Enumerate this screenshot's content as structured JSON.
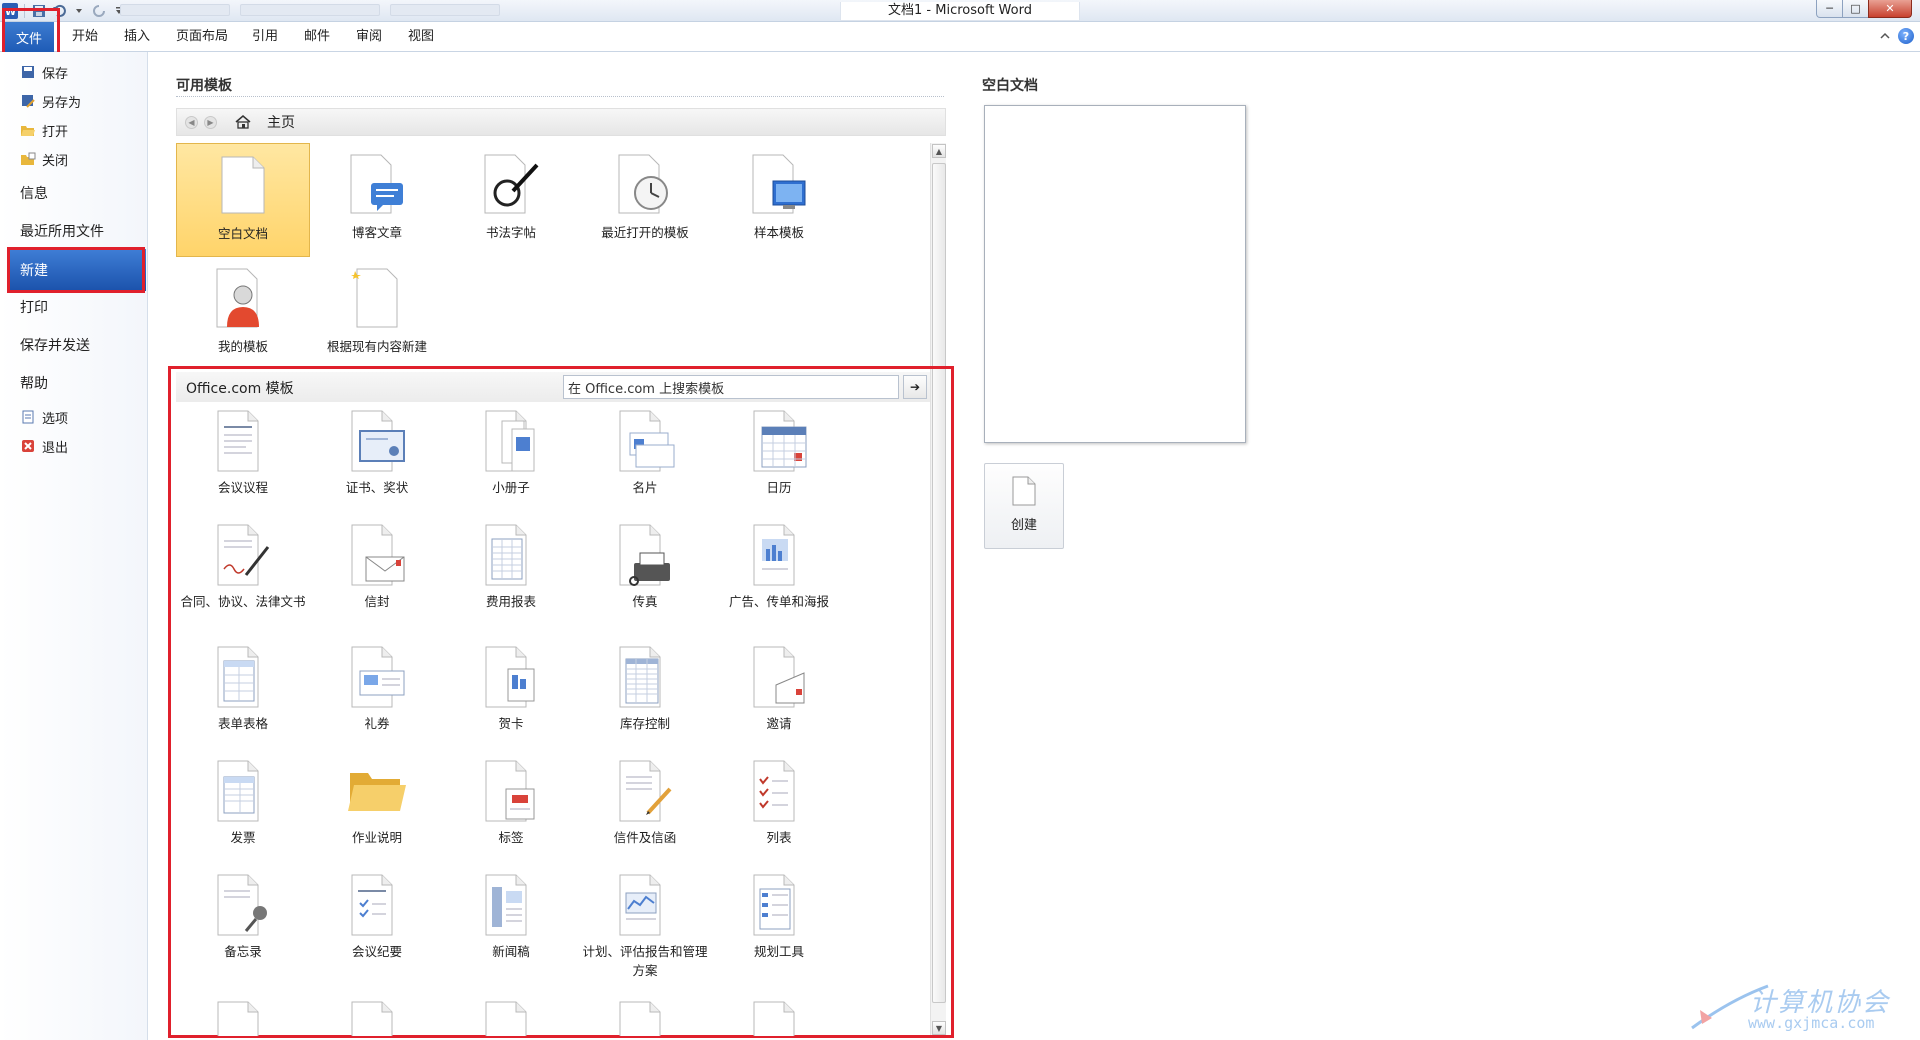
{
  "window": {
    "title": "文档1 - Microsoft Word",
    "controls": {
      "minimize": "─",
      "maximize": "□",
      "close": "✕"
    }
  },
  "ribbon": {
    "file_tab": "文件",
    "tabs": [
      "开始",
      "插入",
      "页面布局",
      "引用",
      "邮件",
      "审阅",
      "视图"
    ]
  },
  "leftnav": {
    "save": "保存",
    "save_as": "另存为",
    "open": "打开",
    "close": "关闭",
    "info": "信息",
    "recent": "最近所用文件",
    "new": "新建",
    "print": "打印",
    "save_send": "保存并发送",
    "help": "帮助",
    "options": "选项",
    "exit": "退出"
  },
  "available": {
    "title": "可用模板",
    "home": "主页",
    "tiles": [
      {
        "label": "空白文档",
        "icon": "blank-document-icon"
      },
      {
        "label": "博客文章",
        "icon": "blog-post-icon"
      },
      {
        "label": "书法字帖",
        "icon": "calligraphy-icon"
      },
      {
        "label": "最近打开的模板",
        "icon": "recent-templates-icon"
      },
      {
        "label": "样本模板",
        "icon": "sample-templates-icon"
      },
      {
        "label": "我的模板",
        "icon": "my-templates-icon"
      },
      {
        "label": "根据现有内容新建",
        "icon": "new-from-existing-icon"
      }
    ]
  },
  "office": {
    "title": "Office.com 模板",
    "search_value": "在 Office.com 上搜索模板",
    "go": "➔",
    "tiles": [
      {
        "label": "会议议程",
        "icon": "agenda-icon"
      },
      {
        "label": "证书、奖状",
        "icon": "certificate-icon"
      },
      {
        "label": "小册子",
        "icon": "brochure-icon"
      },
      {
        "label": "名片",
        "icon": "business-card-icon"
      },
      {
        "label": "日历",
        "icon": "calendar-icon"
      },
      {
        "label": "合同、协议、法律文书",
        "icon": "contract-icon"
      },
      {
        "label": "信封",
        "icon": "envelope-icon"
      },
      {
        "label": "费用报表",
        "icon": "expense-report-icon"
      },
      {
        "label": "传真",
        "icon": "fax-icon"
      },
      {
        "label": "广告、传单和海报",
        "icon": "flyer-icon"
      },
      {
        "label": "表单表格",
        "icon": "form-icon"
      },
      {
        "label": "礼券",
        "icon": "gift-certificate-icon"
      },
      {
        "label": "贺卡",
        "icon": "greeting-card-icon"
      },
      {
        "label": "库存控制",
        "icon": "inventory-icon"
      },
      {
        "label": "邀请",
        "icon": "invitation-icon"
      },
      {
        "label": "发票",
        "icon": "invoice-icon"
      },
      {
        "label": "作业说明",
        "icon": "folder-icon"
      },
      {
        "label": "标签",
        "icon": "label-icon"
      },
      {
        "label": "信件及信函",
        "icon": "letter-icon"
      },
      {
        "label": "列表",
        "icon": "list-icon"
      },
      {
        "label": "备忘录",
        "icon": "memo-icon"
      },
      {
        "label": "会议纪要",
        "icon": "minutes-icon"
      },
      {
        "label": "新闻稿",
        "icon": "newsletter-icon"
      },
      {
        "label": "计划、评估报告和管理方案",
        "icon": "plan-icon"
      },
      {
        "label": "规划工具",
        "icon": "planner-icon"
      }
    ]
  },
  "preview": {
    "title": "空白文档",
    "create": "创建"
  },
  "watermark": {
    "text": "计算机协会",
    "url": "www.gxjmca.com"
  }
}
